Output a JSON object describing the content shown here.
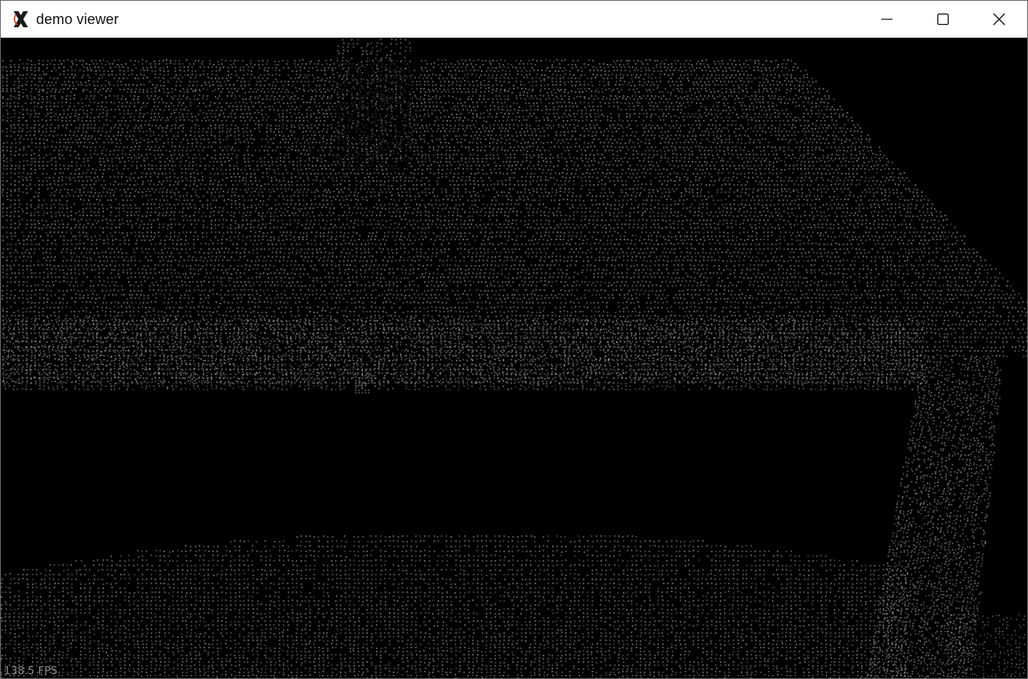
{
  "window": {
    "title": "demo viewer",
    "app_icon": "x-app-icon",
    "controls": {
      "minimize_icon": "minimize-icon",
      "maximize_icon": "maximize-icon",
      "close_icon": "close-icon"
    }
  },
  "viewport": {
    "content": "point-cloud",
    "background_color": "#000000",
    "point_color": "#d8d8d8"
  },
  "status": {
    "fps_text": "138.5 FPS"
  }
}
